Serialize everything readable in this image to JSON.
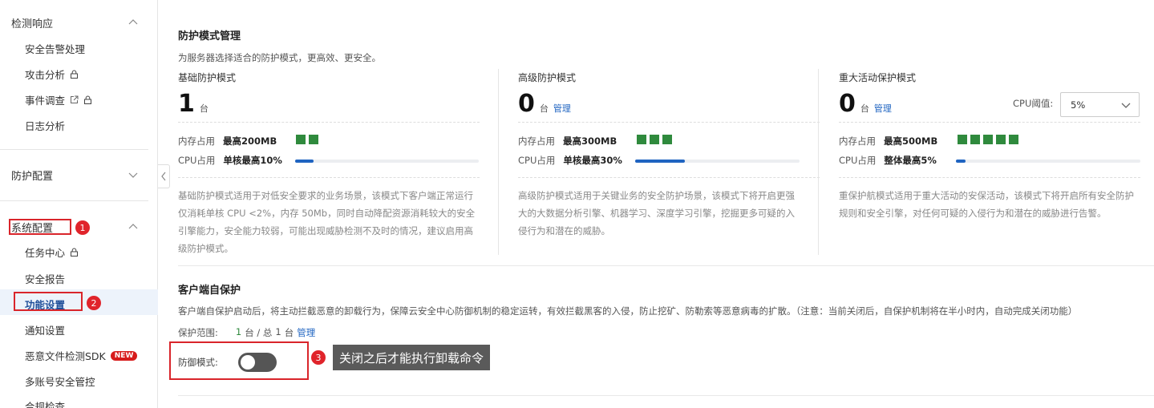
{
  "sidebar": {
    "sections": {
      "detect": "检测响应",
      "protect": "防护配置",
      "system": "系统配置"
    },
    "detect_items": [
      "安全告警处理",
      "攻击分析",
      "事件调查",
      "日志分析"
    ],
    "system_items": [
      "任务中心",
      "安全报告",
      "功能设置",
      "通知设置",
      "恶意文件检测SDK",
      "多账号安全管控",
      "合规检查"
    ],
    "new_badge": "NEW"
  },
  "annotations": {
    "n1": "1",
    "n2": "2",
    "n3": "3"
  },
  "protect_mode": {
    "title": "防护模式管理",
    "desc": "为服务器选择适合的防护模式，更高效、更安全。",
    "cpu_threshold_label": "CPU阈值:",
    "cpu_threshold_value": "5%",
    "unit": "台",
    "manage": "管理",
    "mem_label": "内存占用",
    "cpu_label": "CPU占用",
    "modes": [
      {
        "name": "基础防护模式",
        "count": "1",
        "mem": "最高200MB",
        "mem_blocks": 2,
        "cpu": "单核最高10%",
        "cpu_fill": 0.1,
        "desc": "基础防护模式适用于对低安全要求的业务场景，该模式下客户端正常运行仅消耗单核 CPU <2%，内存 50Mb，同时自动降配资源消耗较大的安全引擎能力，安全能力较弱，可能出现威胁检测不及时的情况，建议启用高级防护模式。"
      },
      {
        "name": "高级防护模式",
        "count": "0",
        "mem": "最高300MB",
        "mem_blocks": 3,
        "cpu": "单核最高30%",
        "cpu_fill": 0.3,
        "desc": "高级防护模式适用于关键业务的安全防护场景，该模式下将开启更强大的大数据分析引擎、机器学习、深度学习引擎，挖掘更多可疑的入侵行为和潜在的威胁。"
      },
      {
        "name": "重大活动保护模式",
        "count": "0",
        "mem": "最高500MB",
        "mem_blocks": 5,
        "cpu": "整体最高5%",
        "cpu_fill": 0.05,
        "desc": "重保护航模式适用于重大活动的安保活动，该模式下将开启所有安全防护规则和安全引擎，对任何可疑的入侵行为和潜在的威胁进行告警。"
      }
    ]
  },
  "self_protect": {
    "title": "客户端自保护",
    "desc": "客户端自保护启动后，将主动拦截恶意的卸载行为，保障云安全中心防御机制的稳定运转，有效拦截黑客的入侵，防止挖矿、防勒索等恶意病毒的扩散。（注意：当前关闭后，自保护机制将在半小时内，自动完成关闭功能）",
    "scope_label": "保护范围:",
    "scope_enabled": "1",
    "scope_mid": "台 / 总",
    "scope_total": "1",
    "scope_unit": "台",
    "manage": "管理",
    "mode_label": "防御模式:",
    "mode_on": false,
    "tooltip": "关闭之后才能执行卸载命令"
  },
  "colors": {
    "accent": "#1f64c1",
    "green_block": "#2f8a3d",
    "annotation_red": "#d9252b"
  }
}
